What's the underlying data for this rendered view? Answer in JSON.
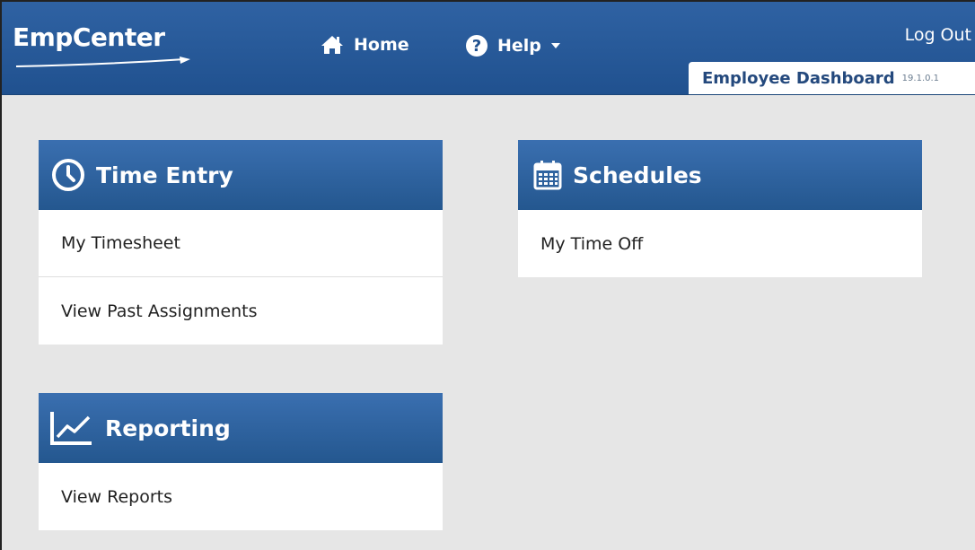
{
  "app": {
    "logo": "EmpCenter",
    "logout_label": "Log Out",
    "context_title": "Employee Dashboard",
    "context_version": "19.1.0.1"
  },
  "nav": {
    "home_label": "Home",
    "help_label": "Help"
  },
  "cards": {
    "time_entry": {
      "title": "Time Entry",
      "icon": "clock-icon",
      "items": [
        "My Timesheet",
        "View Past Assignments"
      ]
    },
    "schedules": {
      "title": "Schedules",
      "icon": "calendar-icon",
      "items": [
        "My Time Off"
      ]
    },
    "reporting": {
      "title": "Reporting",
      "icon": "line-chart-icon",
      "items": [
        "View Reports"
      ]
    }
  },
  "colors": {
    "header": "#2a5c9c",
    "card_header": "#3366a6",
    "background": "#e6e6e6"
  }
}
